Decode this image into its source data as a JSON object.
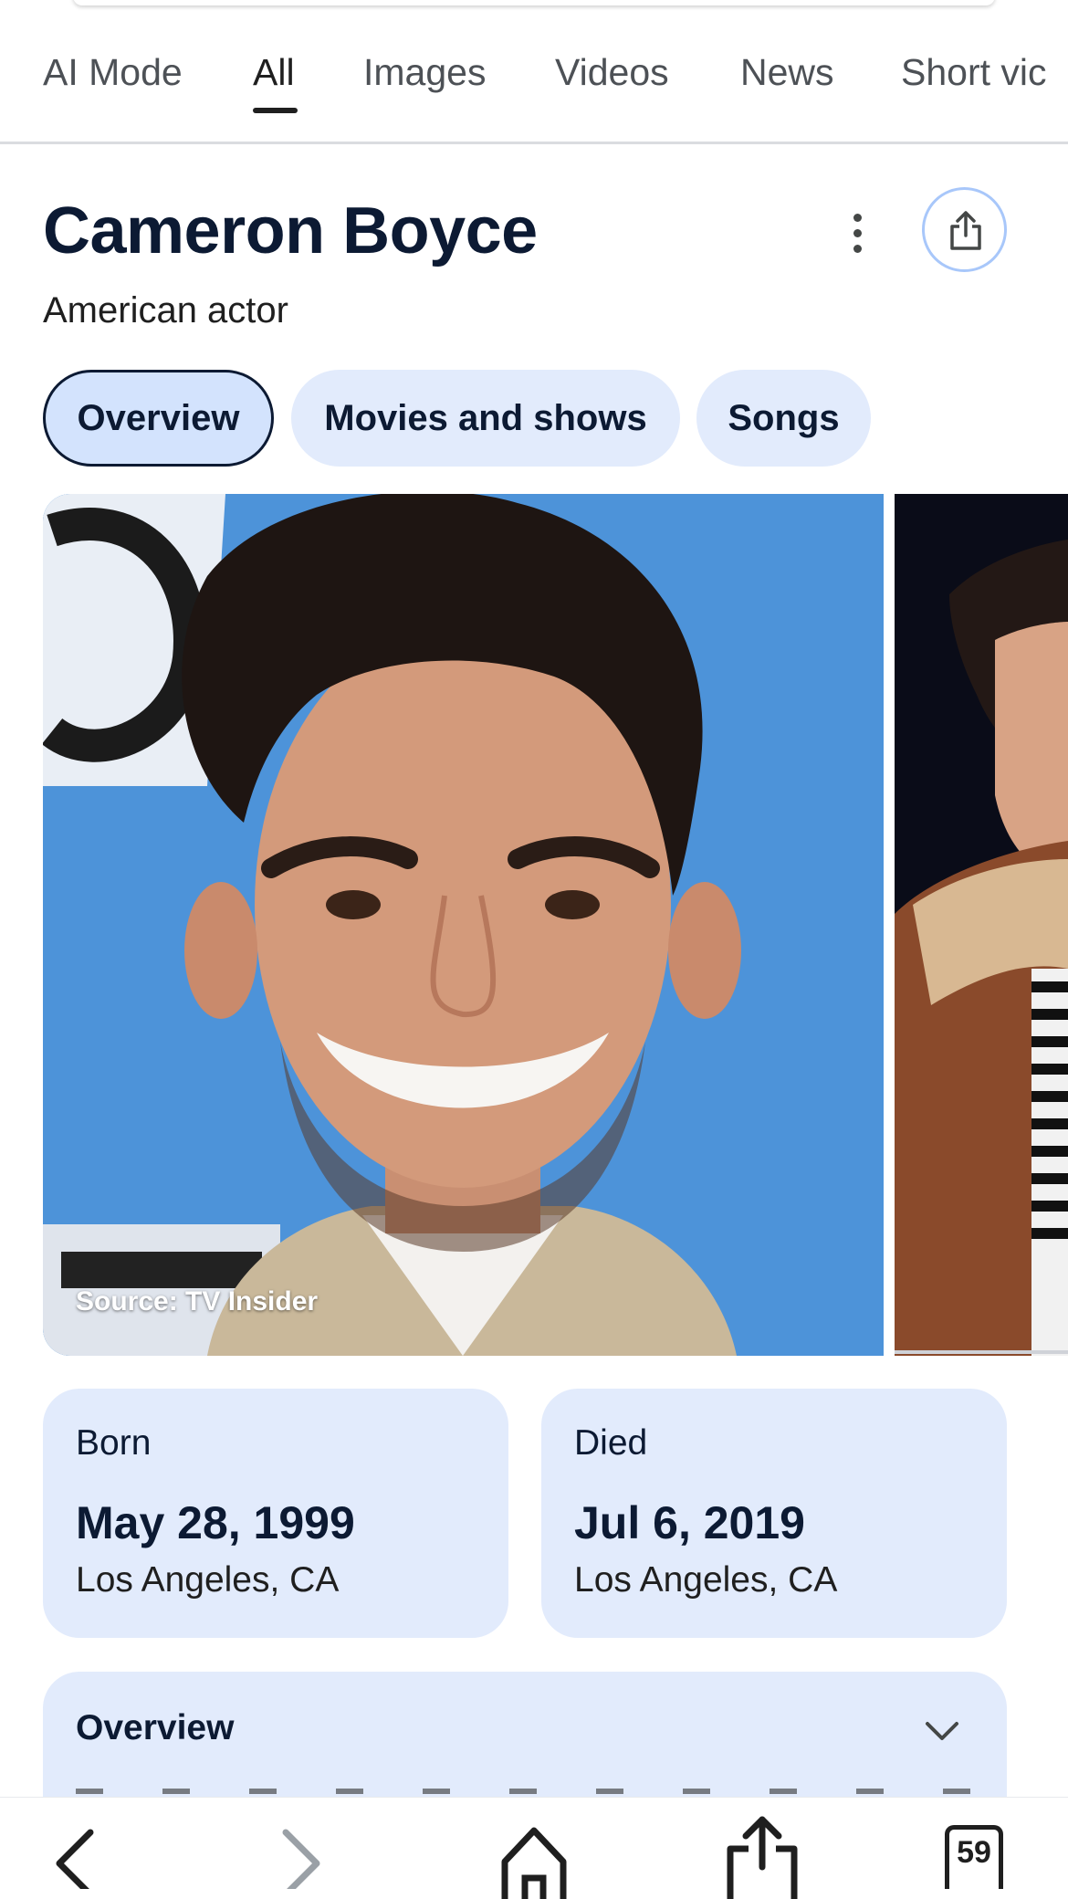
{
  "tabs": [
    {
      "label": "AI Mode"
    },
    {
      "label": "All"
    },
    {
      "label": "Images"
    },
    {
      "label": "Videos"
    },
    {
      "label": "News"
    },
    {
      "label": "Short vic"
    }
  ],
  "active_tab": "All",
  "entity": {
    "title": "Cameron Boyce",
    "subtitle": "American actor",
    "icons": {
      "more": "more-vert-icon",
      "share": "share-icon"
    }
  },
  "chips": [
    {
      "label": "Overview",
      "active": true
    },
    {
      "label": "Movies and shows",
      "active": false
    },
    {
      "label": "Songs",
      "active": false
    }
  ],
  "photos": {
    "main_caption": "Source: TV Insider"
  },
  "facts": {
    "born": {
      "label": "Born",
      "date": "May 28, 1999",
      "place": "Los Angeles, CA"
    },
    "died": {
      "label": "Died",
      "date": "Jul 6, 2019",
      "place": "Los Angeles, CA"
    }
  },
  "overview_section": {
    "title": "Overview",
    "icon": "chevron-down-icon"
  },
  "bottom_bar": {
    "tab_count": "59",
    "icons": [
      "back-arrow-icon",
      "forward-arrow-icon",
      "home-icon",
      "share-icon",
      "tabs-icon"
    ]
  },
  "colors": {
    "accent": "#0c1a33",
    "chip_bg": "#e2ebfc",
    "chip_active_bg": "#d3e3fd",
    "share_ring": "#a8c7fa"
  }
}
